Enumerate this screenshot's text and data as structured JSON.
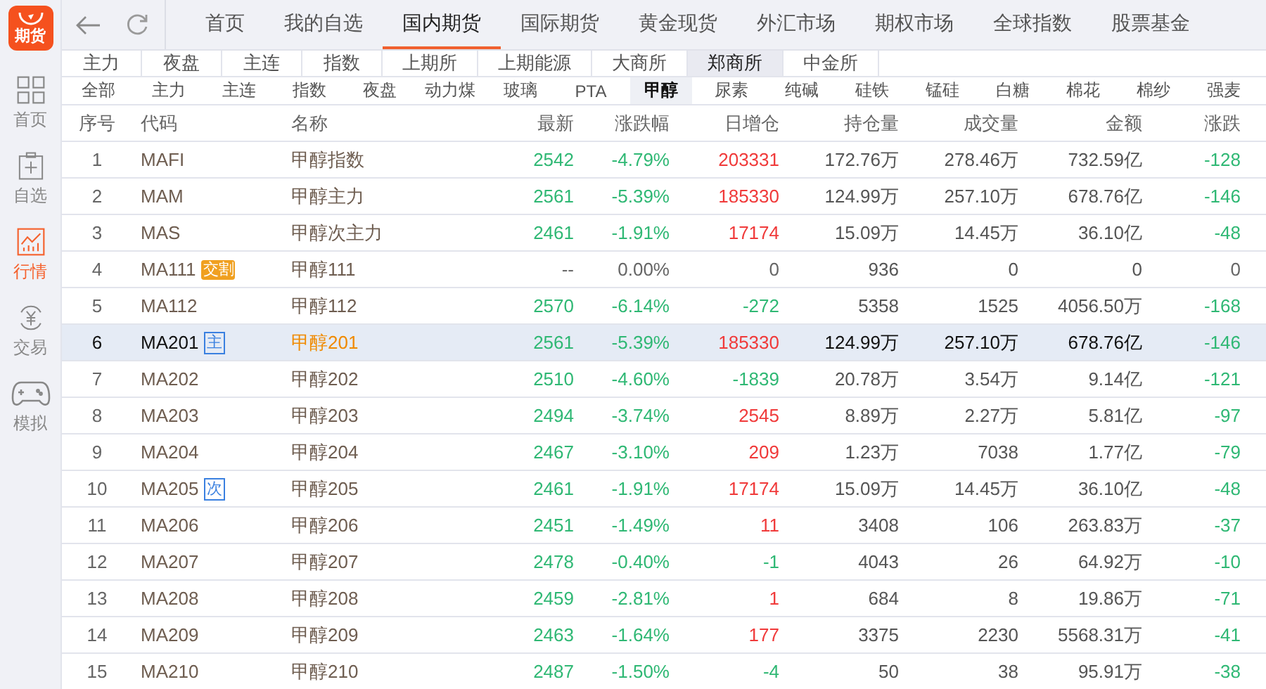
{
  "logo": {
    "text": "期货"
  },
  "sidebar": {
    "items": [
      {
        "label": "首页",
        "selected": false
      },
      {
        "label": "自选",
        "selected": false
      },
      {
        "label": "行情",
        "selected": true
      },
      {
        "label": "交易",
        "selected": false
      },
      {
        "label": "模拟",
        "selected": false
      }
    ]
  },
  "nav": {
    "tabs": [
      {
        "label": "首页",
        "selected": false
      },
      {
        "label": "我的自选",
        "selected": false
      },
      {
        "label": "国内期货",
        "selected": true
      },
      {
        "label": "国际期货",
        "selected": false
      },
      {
        "label": "黄金现货",
        "selected": false
      },
      {
        "label": "外汇市场",
        "selected": false
      },
      {
        "label": "期权市场",
        "selected": false
      },
      {
        "label": "全球指数",
        "selected": false
      },
      {
        "label": "股票基金",
        "selected": false
      }
    ]
  },
  "exchange_tabs": [
    {
      "label": "主力",
      "selected": false
    },
    {
      "label": "夜盘",
      "selected": false
    },
    {
      "label": "主连",
      "selected": false
    },
    {
      "label": "指数",
      "selected": false
    },
    {
      "label": "上期所",
      "selected": false
    },
    {
      "label": "上期能源",
      "selected": false
    },
    {
      "label": "大商所",
      "selected": false
    },
    {
      "label": "郑商所",
      "selected": true
    },
    {
      "label": "中金所",
      "selected": false
    }
  ],
  "product_tabs": [
    {
      "label": "全部",
      "selected": false
    },
    {
      "label": "主力",
      "selected": false
    },
    {
      "label": "主连",
      "selected": false
    },
    {
      "label": "指数",
      "selected": false
    },
    {
      "label": "夜盘",
      "selected": false
    },
    {
      "label": "动力煤",
      "selected": false
    },
    {
      "label": "玻璃",
      "selected": false
    },
    {
      "label": "PTA",
      "selected": false
    },
    {
      "label": "甲醇",
      "selected": true
    },
    {
      "label": "尿素",
      "selected": false
    },
    {
      "label": "纯碱",
      "selected": false
    },
    {
      "label": "硅铁",
      "selected": false
    },
    {
      "label": "锰硅",
      "selected": false
    },
    {
      "label": "白糖",
      "selected": false
    },
    {
      "label": "棉花",
      "selected": false
    },
    {
      "label": "棉纱",
      "selected": false
    },
    {
      "label": "强麦",
      "selected": false
    }
  ],
  "table": {
    "columns": [
      "序号",
      "代码",
      "名称",
      "最新",
      "涨跌幅",
      "日增仓",
      "持仓量",
      "成交量",
      "金额",
      "涨跌"
    ],
    "rows": [
      {
        "index": "1",
        "code": "MAFI",
        "name": "甲醇指数",
        "latest": {
          "text": "2542",
          "color": "#2fb874"
        },
        "change_pct": {
          "text": "-4.79%",
          "color": "#2fb874"
        },
        "daily_oi": {
          "text": "203331",
          "color": "#f03a3a"
        },
        "open_interest": "172.76万",
        "volume": "278.46万",
        "turnover": "732.59亿",
        "change": {
          "text": "-128",
          "color": "#2fb874"
        },
        "selected": false
      },
      {
        "index": "2",
        "code": "MAM",
        "name": "甲醇主力",
        "latest": {
          "text": "2561",
          "color": "#2fb874"
        },
        "change_pct": {
          "text": "-5.39%",
          "color": "#2fb874"
        },
        "daily_oi": {
          "text": "185330",
          "color": "#f03a3a"
        },
        "open_interest": "124.99万",
        "volume": "257.10万",
        "turnover": "678.76亿",
        "change": {
          "text": "-146",
          "color": "#2fb874"
        },
        "selected": false
      },
      {
        "index": "3",
        "code": "MAS",
        "name": "甲醇次主力",
        "latest": {
          "text": "2461",
          "color": "#2fb874"
        },
        "change_pct": {
          "text": "-1.91%",
          "color": "#2fb874"
        },
        "daily_oi": {
          "text": "17174",
          "color": "#f03a3a"
        },
        "open_interest": "15.09万",
        "volume": "14.45万",
        "turnover": "36.10亿",
        "change": {
          "text": "-48",
          "color": "#2fb874"
        },
        "selected": false
      },
      {
        "index": "4",
        "code": "MA111",
        "badge": {
          "kind": "delivery",
          "text": "交割"
        },
        "name": "甲醇111",
        "latest": {
          "text": "--",
          "color": "#666666"
        },
        "change_pct": {
          "text": "0.00%",
          "color": "#666666"
        },
        "daily_oi": {
          "text": "0",
          "color": "#666666"
        },
        "open_interest": "936",
        "volume": "0",
        "turnover": "0",
        "change": {
          "text": "0",
          "color": "#666666"
        },
        "selected": false
      },
      {
        "index": "5",
        "code": "MA112",
        "name": "甲醇112",
        "latest": {
          "text": "2570",
          "color": "#2fb874"
        },
        "change_pct": {
          "text": "-6.14%",
          "color": "#2fb874"
        },
        "daily_oi": {
          "text": "-272",
          "color": "#2fb874"
        },
        "open_interest": "5358",
        "volume": "1525",
        "turnover": "4056.50万",
        "change": {
          "text": "-168",
          "color": "#2fb874"
        },
        "selected": false
      },
      {
        "index": "6",
        "code": "MA201",
        "badge": {
          "kind": "main",
          "text": "主"
        },
        "name": "甲醇201",
        "latest": {
          "text": "2561",
          "color": "#2fb874"
        },
        "change_pct": {
          "text": "-5.39%",
          "color": "#2fb874"
        },
        "daily_oi": {
          "text": "185330",
          "color": "#f03a3a"
        },
        "open_interest": "124.99万",
        "volume": "257.10万",
        "turnover": "678.76亿",
        "change": {
          "text": "-146",
          "color": "#2fb874"
        },
        "selected": true
      },
      {
        "index": "7",
        "code": "MA202",
        "name": "甲醇202",
        "latest": {
          "text": "2510",
          "color": "#2fb874"
        },
        "change_pct": {
          "text": "-4.60%",
          "color": "#2fb874"
        },
        "daily_oi": {
          "text": "-1839",
          "color": "#2fb874"
        },
        "open_interest": "20.78万",
        "volume": "3.54万",
        "turnover": "9.14亿",
        "change": {
          "text": "-121",
          "color": "#2fb874"
        },
        "selected": false
      },
      {
        "index": "8",
        "code": "MA203",
        "name": "甲醇203",
        "latest": {
          "text": "2494",
          "color": "#2fb874"
        },
        "change_pct": {
          "text": "-3.74%",
          "color": "#2fb874"
        },
        "daily_oi": {
          "text": "2545",
          "color": "#f03a3a"
        },
        "open_interest": "8.89万",
        "volume": "2.27万",
        "turnover": "5.81亿",
        "change": {
          "text": "-97",
          "color": "#2fb874"
        },
        "selected": false
      },
      {
        "index": "9",
        "code": "MA204",
        "name": "甲醇204",
        "latest": {
          "text": "2467",
          "color": "#2fb874"
        },
        "change_pct": {
          "text": "-3.10%",
          "color": "#2fb874"
        },
        "daily_oi": {
          "text": "209",
          "color": "#f03a3a"
        },
        "open_interest": "1.23万",
        "volume": "7038",
        "turnover": "1.77亿",
        "change": {
          "text": "-79",
          "color": "#2fb874"
        },
        "selected": false
      },
      {
        "index": "10",
        "code": "MA205",
        "badge": {
          "kind": "secondary",
          "text": "次"
        },
        "name": "甲醇205",
        "latest": {
          "text": "2461",
          "color": "#2fb874"
        },
        "change_pct": {
          "text": "-1.91%",
          "color": "#2fb874"
        },
        "daily_oi": {
          "text": "17174",
          "color": "#f03a3a"
        },
        "open_interest": "15.09万",
        "volume": "14.45万",
        "turnover": "36.10亿",
        "change": {
          "text": "-48",
          "color": "#2fb874"
        },
        "selected": false
      },
      {
        "index": "11",
        "code": "MA206",
        "name": "甲醇206",
        "latest": {
          "text": "2451",
          "color": "#2fb874"
        },
        "change_pct": {
          "text": "-1.49%",
          "color": "#2fb874"
        },
        "daily_oi": {
          "text": "11",
          "color": "#f03a3a"
        },
        "open_interest": "3408",
        "volume": "106",
        "turnover": "263.83万",
        "change": {
          "text": "-37",
          "color": "#2fb874"
        },
        "selected": false
      },
      {
        "index": "12",
        "code": "MA207",
        "name": "甲醇207",
        "latest": {
          "text": "2478",
          "color": "#2fb874"
        },
        "change_pct": {
          "text": "-0.40%",
          "color": "#2fb874"
        },
        "daily_oi": {
          "text": "-1",
          "color": "#2fb874"
        },
        "open_interest": "4043",
        "volume": "26",
        "turnover": "64.92万",
        "change": {
          "text": "-10",
          "color": "#2fb874"
        },
        "selected": false
      },
      {
        "index": "13",
        "code": "MA208",
        "name": "甲醇208",
        "latest": {
          "text": "2459",
          "color": "#2fb874"
        },
        "change_pct": {
          "text": "-2.81%",
          "color": "#2fb874"
        },
        "daily_oi": {
          "text": "1",
          "color": "#f03a3a"
        },
        "open_interest": "684",
        "volume": "8",
        "turnover": "19.86万",
        "change": {
          "text": "-71",
          "color": "#2fb874"
        },
        "selected": false
      },
      {
        "index": "14",
        "code": "MA209",
        "name": "甲醇209",
        "latest": {
          "text": "2463",
          "color": "#2fb874"
        },
        "change_pct": {
          "text": "-1.64%",
          "color": "#2fb874"
        },
        "daily_oi": {
          "text": "177",
          "color": "#f03a3a"
        },
        "open_interest": "3375",
        "volume": "2230",
        "turnover": "5568.31万",
        "change": {
          "text": "-41",
          "color": "#2fb874"
        },
        "selected": false
      },
      {
        "index": "15",
        "code": "MA210",
        "name": "甲醇210",
        "latest": {
          "text": "2487",
          "color": "#2fb874"
        },
        "change_pct": {
          "text": "-1.50%",
          "color": "#2fb874"
        },
        "daily_oi": {
          "text": "-4",
          "color": "#2fb874"
        },
        "open_interest": "50",
        "volume": "38",
        "turnover": "95.91万",
        "change": {
          "text": "-38",
          "color": "#2fb874"
        },
        "selected": false
      }
    ]
  }
}
